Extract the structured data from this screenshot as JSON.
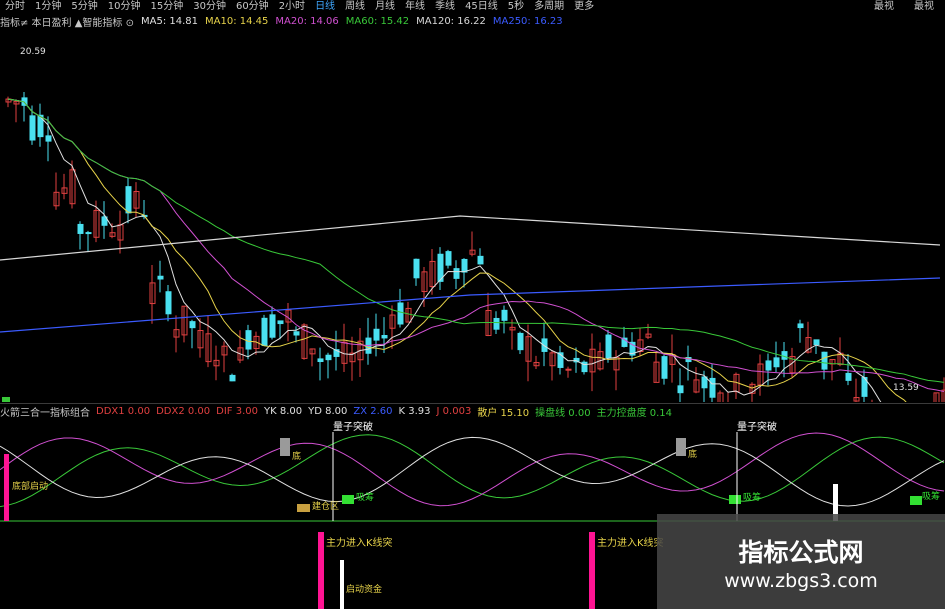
{
  "toolbar": {
    "items": [
      "分时",
      "1分钟",
      "5分钟",
      "10分钟",
      "15分钟",
      "30分钟",
      "60分钟",
      "2小时",
      "日线",
      "周线",
      "月线",
      "年线",
      "季线",
      "45日线",
      "5秒",
      "多周期",
      "更多"
    ],
    "active_index": 8,
    "right": [
      "最视",
      "最视"
    ]
  },
  "ma_row": {
    "prefix": "指标≠ 本日盈利 ▲智能指标 ⊙",
    "items": [
      {
        "text": "MA5: 14.81",
        "color": "#e0e0e0"
      },
      {
        "text": "MA10: 14.45",
        "color": "#e6d24a"
      },
      {
        "text": "MA20: 14.06",
        "color": "#d050d0"
      },
      {
        "text": "MA60: 15.42",
        "color": "#39c839"
      },
      {
        "text": "MA120: 16.22",
        "color": "#d8d8d8"
      },
      {
        "text": "MA250: 16.23",
        "color": "#3b5bff"
      }
    ]
  },
  "price_labels": {
    "high": "20.59",
    "low": "13.59"
  },
  "indicator_row": {
    "name": "火箭三合一指标组合",
    "items": [
      {
        "text": "DDX1 0.00",
        "color": "#e04040"
      },
      {
        "text": "DDX2 0.00",
        "color": "#e04040"
      },
      {
        "text": "DIF 3.00",
        "color": "#e04040"
      },
      {
        "text": "YK 8.00",
        "color": "#e0e0e0"
      },
      {
        "text": "YD 8.00",
        "color": "#e0e0e0"
      },
      {
        "text": "ZX 2.60",
        "color": "#3b5bff"
      },
      {
        "text": "K 3.93",
        "color": "#e0e0e0"
      },
      {
        "text": "J 0.003",
        "color": "#e04040"
      },
      {
        "text": "散户 15.10",
        "color": "#e6d24a"
      },
      {
        "text": "操盘线 0.00",
        "color": "#39c839"
      },
      {
        "text": "主力控盘度 0.14",
        "color": "#39c839"
      }
    ]
  },
  "sub_labels": {
    "rocket1": "量子突破",
    "rocket2": "量子突破",
    "low1": "底",
    "low2": "底",
    "start": "底部启动",
    "buy1": "建仓区",
    "buy2": "吸筹",
    "buy3": "吸筹",
    "buy4": "吸筹",
    "main1": "主力进入K线突",
    "main2": "主力进入K线突",
    "main3": "启动资金"
  },
  "watermark": {
    "title": "指标公式网",
    "url": "www.zbgs3.com"
  },
  "colors": {
    "up": "#e04040",
    "down": "#4ae0f0",
    "ma5": "#e0e0e0",
    "ma10": "#e6d24a",
    "ma20": "#d050d0",
    "ma60": "#39c839",
    "ma120": "#d8d8d8",
    "ma250": "#3b5bff",
    "magenta": "#ff1493"
  }
}
